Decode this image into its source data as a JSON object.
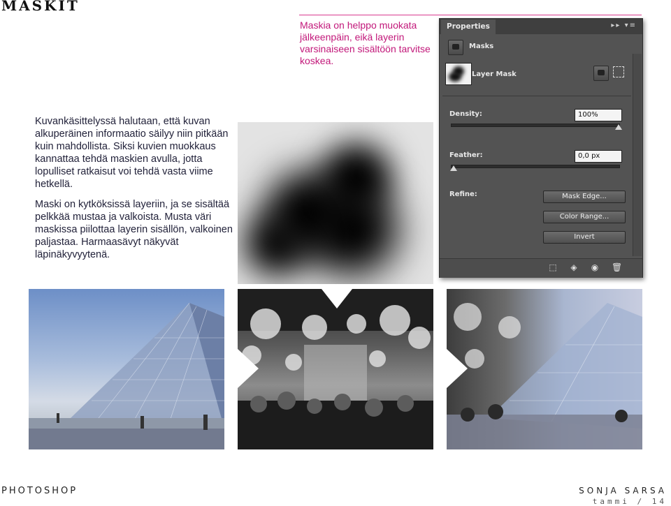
{
  "header": {
    "title": "MASKIT"
  },
  "note": "Maskia on helppo muokata jälkeenpäin, eikä layerin varsinaiseen sisältöön tarvitse koskea.",
  "paragraphs": [
    "Kuvankäsittelyssä halutaan, että kuvan alkuperäinen informaatio säilyy niin pitkään kuin mahdollista. Siksi kuvien muokkaus kannattaa tehdä maskien avulla, jotta lopulliset ratkaisut voi tehdä vasta viime hetkellä.",
    "Maski on kytköksissä layeriin, ja se sisältää pelkkää mustaa ja valkoista. Musta väri maskissa piilottaa layerin sisällön, valkoinen paljastaa. Harmaasävyt näkyvät läpinäkyvyytenä."
  ],
  "properties_panel": {
    "tab": "Properties",
    "masks_label": "Masks",
    "layer_mask_label": "Layer Mask",
    "density_label": "Density:",
    "density_value": "100%",
    "density_level": 1.0,
    "feather_label": "Feather:",
    "feather_value": "0,0 px",
    "feather_level": 0.0,
    "refine_label": "Refine:",
    "buttons": [
      "Mask Edge...",
      "Color Range...",
      "Invert"
    ]
  },
  "footer": {
    "section": "PHOTOSHOP",
    "author": "SONJA SARSA",
    "page": "tammi / 14"
  },
  "colors": {
    "accent": "#c2187a",
    "panel": "#535353"
  }
}
